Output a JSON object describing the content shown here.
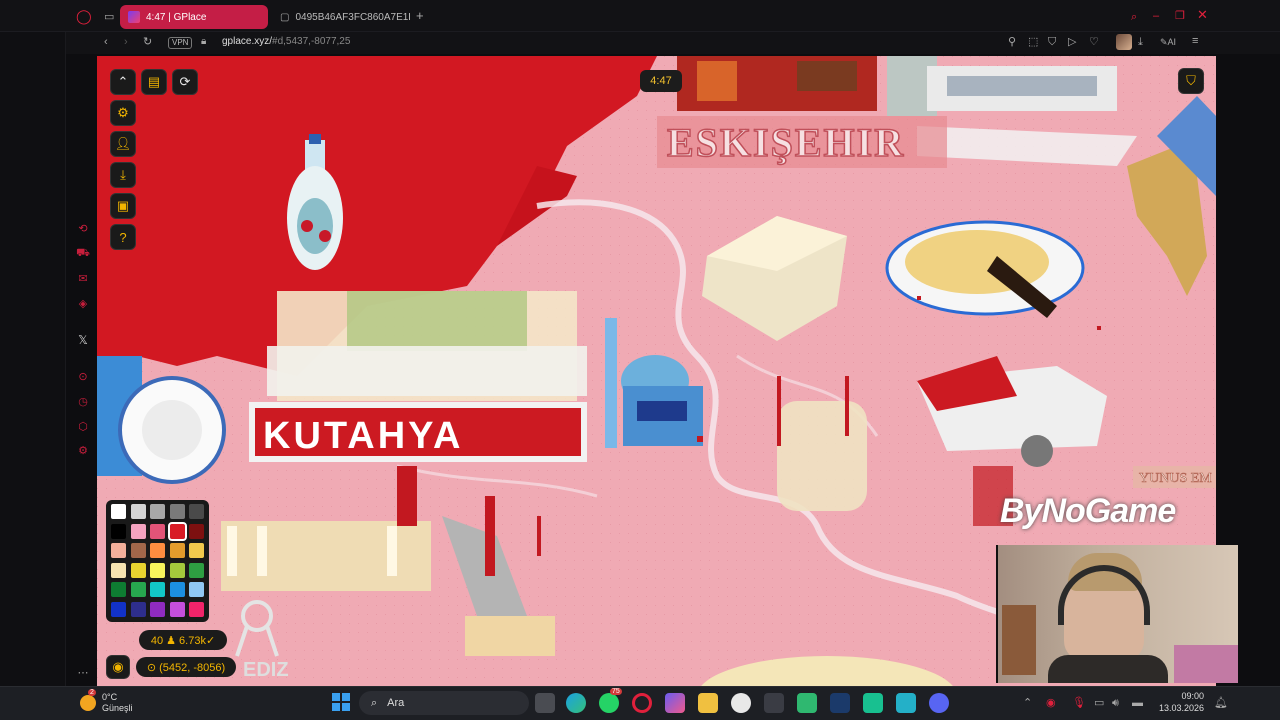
{
  "browser": {
    "tabs": [
      {
        "title": "4:47 | GPlace",
        "active": true
      },
      {
        "title": "0495B46AF3FC860A7E1E",
        "active": false
      }
    ],
    "address": {
      "host": "gplace.xyz/",
      "path": "#d,5437,-8077,25",
      "vpn_label": "VPN"
    },
    "ai_label": "AI"
  },
  "game": {
    "timer": "4:47",
    "pixel_stats": "40 ♟ 6.73k✓",
    "coordinates": "⊙ (5452, -8056)",
    "palette_colors": [
      "#ffffff",
      "#d4d4d4",
      "#a8a8a8",
      "#7a7a7a",
      "#4a4a4a",
      "#000000",
      "#f4a3c0",
      "#e25478",
      "#d81b25",
      "#7d1010",
      "#f4b09b",
      "#a2674a",
      "#ff8d40",
      "#e39c2c",
      "#f2c94d",
      "#f7e4b1",
      "#e8d430",
      "#f8f55c",
      "#a4c93c",
      "#2e9e42",
      "#0e7d32",
      "#27a84f",
      "#12c8c7",
      "#1c8fe0",
      "#90c8f4",
      "#1232c8",
      "#2e2e8c",
      "#8f2bbf",
      "#c54fdc",
      "#f2246a"
    ],
    "selected_color_index": 8
  },
  "map": {
    "labels": [
      "ESKIŞEHIR",
      "KUTAHYA",
      "YUNUS EM",
      "EDIZ"
    ]
  },
  "stream": {
    "brand": "ByNoGame"
  },
  "taskbar": {
    "weather_temp": "0°C",
    "weather_place": "Güneşli",
    "search_label": "Ara",
    "time": "09:00",
    "date": "13.03.2026",
    "notif_badge": "75",
    "weather_badge": "2"
  }
}
